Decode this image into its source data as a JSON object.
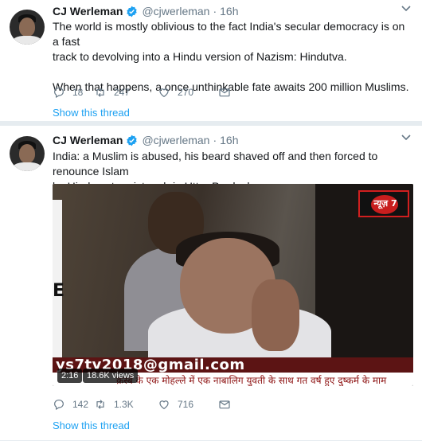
{
  "colors": {
    "link": "#1da1f2",
    "muted": "#657786",
    "text": "#14171a",
    "verified": "#1da1f2"
  },
  "tweets": [
    {
      "author_name": "CJ Werleman",
      "author_handle": "@cjwerleman",
      "separator": "·",
      "time": "16h",
      "text_line1": "The world is mostly oblivious to the fact India's secular democracy is on a fast",
      "text_line2": "track to devolving into a Hindu version of Nazism: Hindutva.",
      "text_line3": "When that happens, a once unthinkable fate awaits 200 million Muslims.",
      "replies": "18",
      "retweets": "247",
      "likes": "270",
      "show_thread": "Show this thread"
    },
    {
      "author_name": "CJ Werleman",
      "author_handle": "@cjwerleman",
      "separator": "·",
      "time": "16h",
      "text_line1": "India: a Muslim is abused, his beard shaved off and then forced to renounce Islam",
      "text_line2": "by Hindu extremist mob in Uttar Pradesh.",
      "video": {
        "duration": "2:16",
        "views": "18.6K views",
        "email_overlay": "ys7tv2018@gmail.com",
        "ticker_text": "क़स्बे के एक मोहल्ले में एक नाबालिग युवती के साथ गत वर्ष हुए दुष्कर्म के माम",
        "left_letter": "E",
        "channel_logo_text": "न्यूज़ 7"
      },
      "replies": "142",
      "retweets": "1.3K",
      "likes": "716",
      "show_thread": "Show this thread"
    }
  ]
}
